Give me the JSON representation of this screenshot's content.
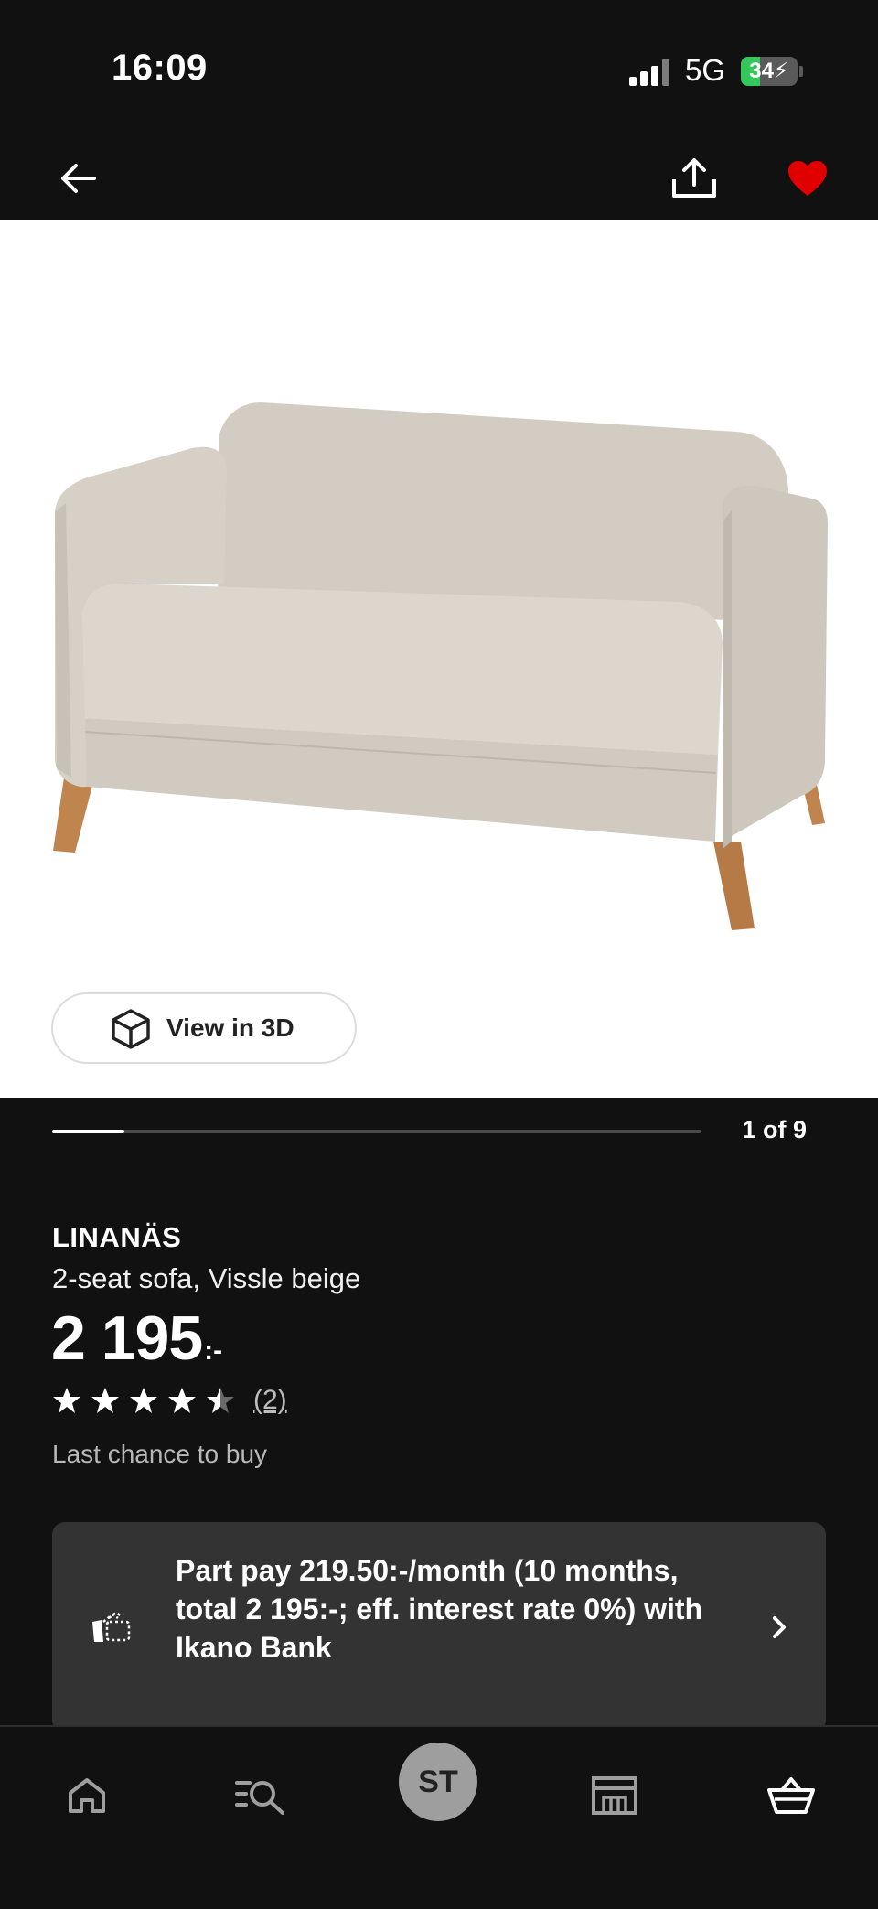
{
  "status_bar": {
    "time": "16:09",
    "network": "5G",
    "battery": "34",
    "battery_level": 0.34,
    "battery_color": "#34c759"
  },
  "nav": {
    "back_icon": "arrow-left-icon",
    "share_icon": "share-icon",
    "favorite_icon": "heart-icon",
    "favorite_color": "#e00000"
  },
  "gallery": {
    "view_3d_label": "View in 3D",
    "view_3d_icon": "cube-icon",
    "page_counter": "1 of 9",
    "current_index": 1,
    "total_images": 9,
    "image_description_icon": "sofa-image"
  },
  "product": {
    "name": "LINANÄS",
    "description": "2-seat sofa, Vissle beige",
    "price": "2 195",
    "price_suffix": ":-",
    "rating": 4.5,
    "rating_max": 5,
    "review_count": "(2)",
    "availability": "Last chance to buy"
  },
  "part_pay": {
    "text": "Part pay 219.50:-/month (10 months, total 2 195:-; eff. interest rate 0%) with Ikano Bank",
    "icon": "payment-hand-icon",
    "chevron_icon": "chevron-right-icon"
  },
  "tab_bar": {
    "tabs": [
      {
        "name": "home",
        "icon": "home-icon"
      },
      {
        "name": "search",
        "icon": "search-list-icon"
      },
      {
        "name": "profile",
        "icon": "avatar",
        "label": "ST"
      },
      {
        "name": "store",
        "icon": "store-icon"
      },
      {
        "name": "basket",
        "icon": "basket-icon"
      }
    ]
  },
  "colors": {
    "background": "#111111",
    "card": "#333333",
    "muted_text": "#b8b8b8"
  }
}
